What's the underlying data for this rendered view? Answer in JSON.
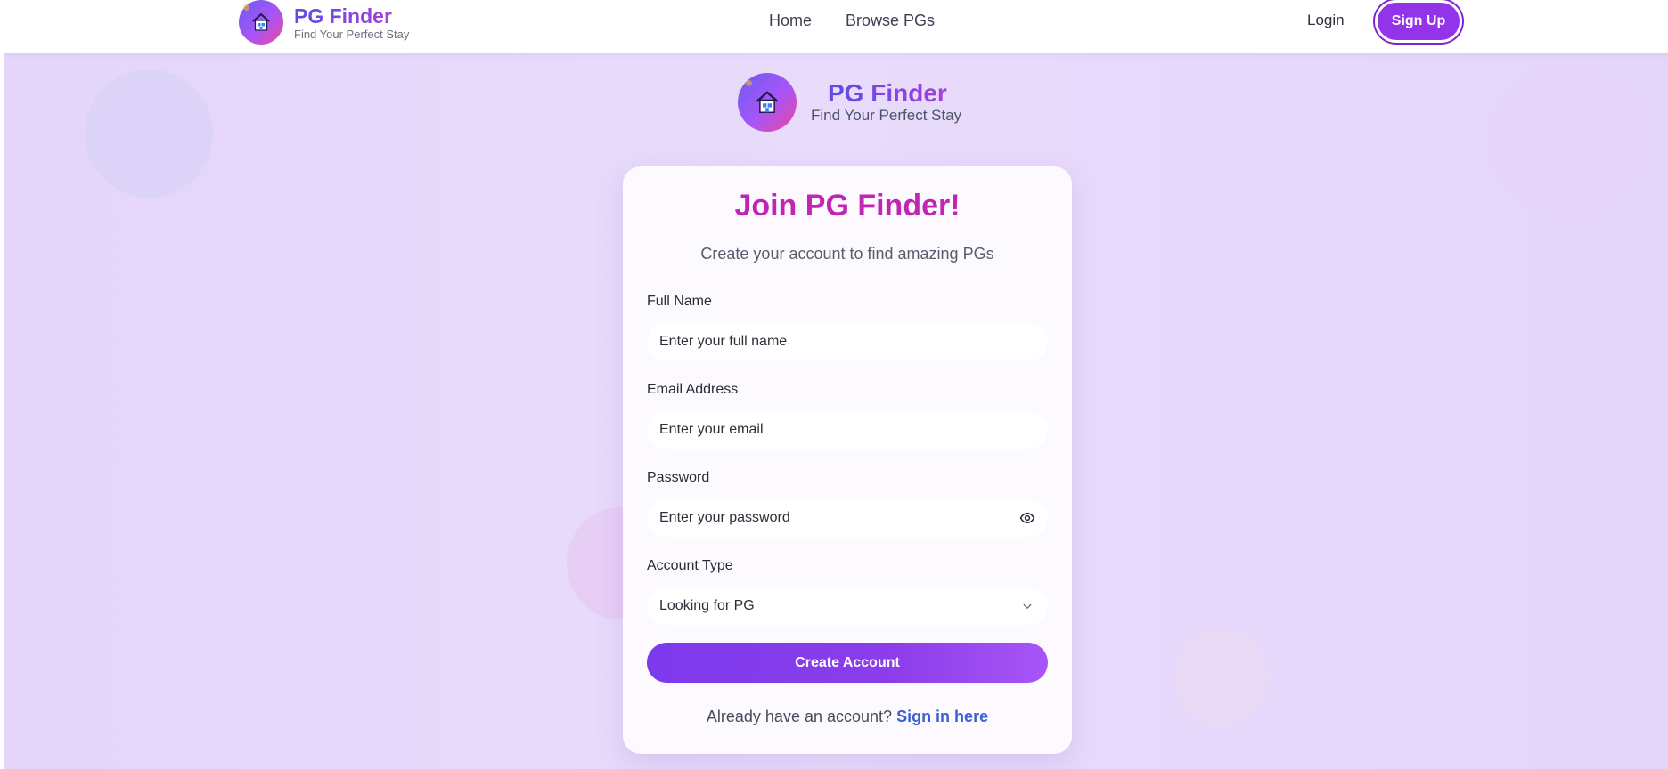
{
  "header": {
    "brand_title": "PG Finder",
    "brand_subtitle": "Find Your Perfect Stay",
    "nav": [
      {
        "label": "Home"
      },
      {
        "label": "Browse PGs"
      }
    ],
    "login_label": "Login",
    "signup_label": "Sign Up"
  },
  "hero": {
    "brand_title": "PG Finder",
    "brand_subtitle": "Find Your Perfect Stay"
  },
  "form": {
    "title": "Join PG Finder!",
    "subtitle": "Create your account to find amazing PGs",
    "full_name": {
      "label": "Full Name",
      "placeholder": "Enter your full name"
    },
    "email": {
      "label": "Email Address",
      "placeholder": "Enter your email"
    },
    "password": {
      "label": "Password",
      "placeholder": "Enter your password"
    },
    "account_type": {
      "label": "Account Type",
      "value": "Looking for PG"
    },
    "submit_label": "Create Account",
    "signin_prompt": "Already have an account?",
    "signin_link": "Sign in here"
  },
  "colors": {
    "accent": "#9333ea",
    "title": "#c026b3",
    "link": "#3b5fd4",
    "background": "#e6d9fa"
  },
  "icons": [
    "house-icon",
    "eye-icon",
    "chevron-down-icon"
  ]
}
